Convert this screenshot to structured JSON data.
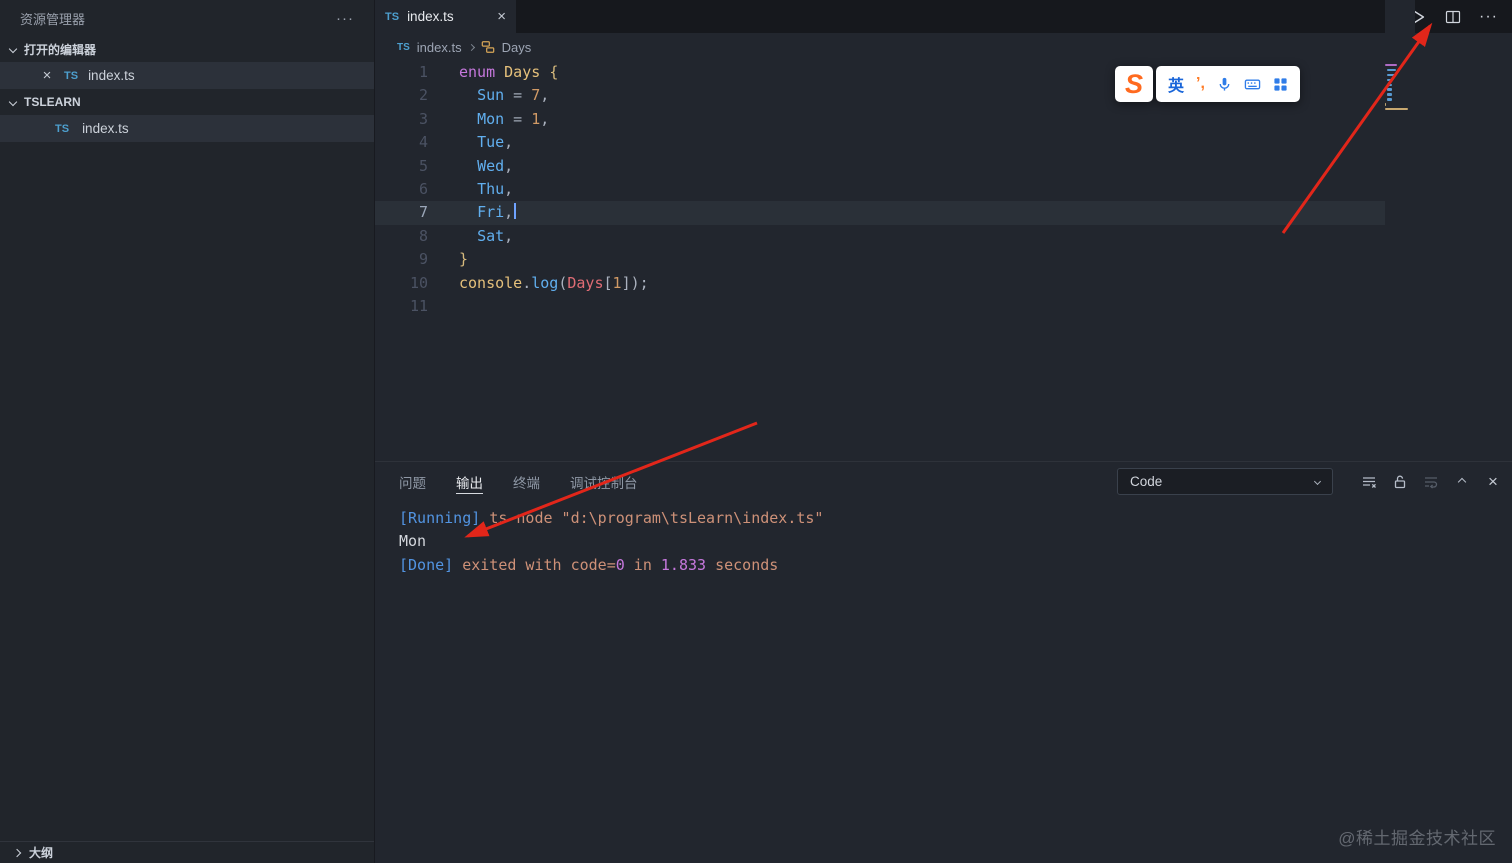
{
  "colors": {
    "accent_red": "#e2261a",
    "ts_blue": "#4d9fce",
    "tokens": {
      "kw": "#c678dd",
      "type": "#e5c07b",
      "brace": "#d7ba7d",
      "member": "#61afef",
      "op": "#9fa8b5",
      "num": "#d19a66",
      "punc": "#abb2bf",
      "plain": "#abb2bf",
      "obj": "#e5c07b",
      "fn": "#61afef",
      "var": "#e06c75"
    },
    "output_tokens": {
      "info": "#5294e2",
      "str": "#ce9178",
      "mag": "#c678dd",
      "plain": "#d4d7dd"
    }
  },
  "icons": {
    "ts_badge": "TS",
    "close": "×",
    "more": "···",
    "sogou_logo": "S",
    "ime_pen": "’,"
  },
  "sidebar": {
    "title": "资源管理器",
    "sections": [
      {
        "label": "打开的编辑器",
        "items": [
          {
            "label": "index.ts",
            "icon": "typescript-file"
          }
        ]
      },
      {
        "label": "TSLEARN",
        "items": [
          {
            "label": "index.ts",
            "icon": "typescript-file"
          }
        ]
      }
    ],
    "outline_label": "大纲"
  },
  "tabbar": {
    "tab_label": "index.ts"
  },
  "breadcrumb": {
    "file": "index.ts",
    "symbol": "Days"
  },
  "editor": {
    "active_line": 7,
    "lines": [
      {
        "tokens": [
          {
            "t": "enum",
            "c": "kw"
          },
          {
            "t": " ",
            "c": "plain"
          },
          {
            "t": "Days",
            "c": "type"
          },
          {
            "t": " ",
            "c": "plain"
          },
          {
            "t": "{",
            "c": "brace"
          }
        ]
      },
      {
        "tokens": [
          {
            "t": "  ",
            "c": "plain"
          },
          {
            "t": "Sun",
            "c": "member"
          },
          {
            "t": " = ",
            "c": "op"
          },
          {
            "t": "7",
            "c": "num"
          },
          {
            "t": ",",
            "c": "punc"
          }
        ]
      },
      {
        "tokens": [
          {
            "t": "  ",
            "c": "plain"
          },
          {
            "t": "Mon",
            "c": "member"
          },
          {
            "t": " = ",
            "c": "op"
          },
          {
            "t": "1",
            "c": "num"
          },
          {
            "t": ",",
            "c": "punc"
          }
        ]
      },
      {
        "tokens": [
          {
            "t": "  ",
            "c": "plain"
          },
          {
            "t": "Tue",
            "c": "member"
          },
          {
            "t": ",",
            "c": "punc"
          }
        ]
      },
      {
        "tokens": [
          {
            "t": "  ",
            "c": "plain"
          },
          {
            "t": "Wed",
            "c": "member"
          },
          {
            "t": ",",
            "c": "punc"
          }
        ]
      },
      {
        "tokens": [
          {
            "t": "  ",
            "c": "plain"
          },
          {
            "t": "Thu",
            "c": "member"
          },
          {
            "t": ",",
            "c": "punc"
          }
        ]
      },
      {
        "tokens": [
          {
            "t": "  ",
            "c": "plain"
          },
          {
            "t": "Fri",
            "c": "member"
          },
          {
            "t": ",",
            "c": "punc"
          }
        ],
        "cursor": true
      },
      {
        "tokens": [
          {
            "t": "  ",
            "c": "plain"
          },
          {
            "t": "Sat",
            "c": "member"
          },
          {
            "t": ",",
            "c": "punc"
          }
        ]
      },
      {
        "tokens": [
          {
            "t": "}",
            "c": "brace"
          }
        ]
      },
      {
        "tokens": [
          {
            "t": "console",
            "c": "obj"
          },
          {
            "t": ".",
            "c": "punc"
          },
          {
            "t": "log",
            "c": "fn"
          },
          {
            "t": "(",
            "c": "punc"
          },
          {
            "t": "Days",
            "c": "var"
          },
          {
            "t": "[",
            "c": "punc"
          },
          {
            "t": "1",
            "c": "num"
          },
          {
            "t": "]",
            "c": "punc"
          },
          {
            "t": ")",
            "c": "punc"
          },
          {
            "t": ";",
            "c": "punc"
          }
        ]
      },
      {
        "tokens": []
      }
    ]
  },
  "ime": {
    "mode": "英"
  },
  "panel": {
    "tabs": [
      {
        "label": "问题",
        "active": false
      },
      {
        "label": "输出",
        "active": true
      },
      {
        "label": "终端",
        "active": false
      },
      {
        "label": "调试控制台",
        "active": false
      }
    ],
    "channel": "Code",
    "output_lines": [
      {
        "tokens": [
          {
            "t": "[Running] ",
            "c": "info"
          },
          {
            "t": "ts-node \"d:\\program\\tsLearn\\index.ts\"",
            "c": "str"
          }
        ]
      },
      {
        "tokens": [
          {
            "t": "Mon",
            "c": "plain"
          }
        ]
      },
      {
        "tokens": []
      },
      {
        "tokens": [
          {
            "t": "[Done]",
            "c": "info"
          },
          {
            "t": " exited with code=",
            "c": "str"
          },
          {
            "t": "0",
            "c": "mag"
          },
          {
            "t": " in ",
            "c": "str"
          },
          {
            "t": "1.833",
            "c": "mag"
          },
          {
            "t": " seconds",
            "c": "str"
          }
        ]
      }
    ]
  },
  "watermark": "@稀土掘金技术社区"
}
